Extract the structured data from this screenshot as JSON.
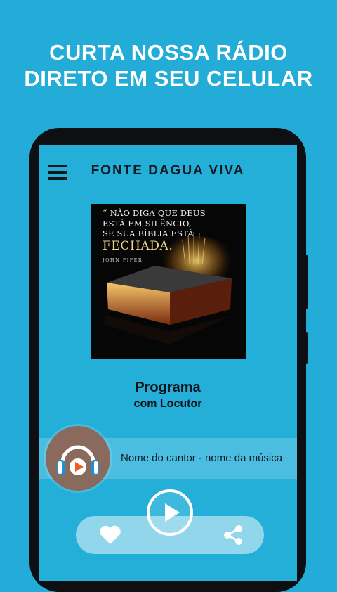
{
  "promo": {
    "headline_line1": "CURTA NOSSA RÁDIO",
    "headline_line2": "DIRETO EM SEU CELULAR"
  },
  "app": {
    "title": "FONTE DAGUA VIVA",
    "menu_icon": "hamburger-menu-icon"
  },
  "cover": {
    "quote_mark": "“",
    "quote_line1": "NÃO DIGA QUE DEUS",
    "quote_line2": "ESTÁ EM SILÊNCIO,",
    "quote_line3": "SE SUA BÍBLIA ESTÁ",
    "quote_emphasis": "FECHADA.",
    "author": "JOHN PIPER"
  },
  "program": {
    "title": "Programa",
    "host": "com Locutor"
  },
  "now_playing": {
    "track": "Nome do cantor - nome da música",
    "avatar_icon": "headphones-icon"
  },
  "controls": {
    "play_icon": "play-icon",
    "favorite_icon": "heart-icon",
    "share_icon": "share-icon"
  },
  "colors": {
    "background": "#23acd7",
    "phone_frame": "#0d0f12",
    "avatar": "#8a6a5d",
    "accent_orange": "#f05a28",
    "accent_blue": "#1f8fd6"
  }
}
